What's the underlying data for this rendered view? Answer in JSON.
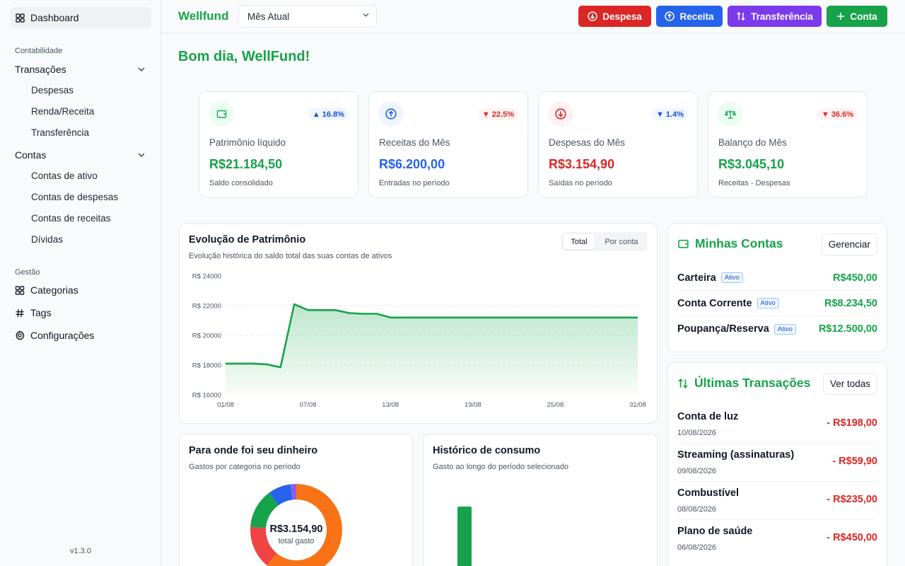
{
  "sidebar": {
    "dashboard": "Dashboard",
    "section_accounting": "Contabilidade",
    "transactions": {
      "label": "Transações",
      "items": [
        "Despesas",
        "Renda/Receita",
        "Transferência"
      ]
    },
    "accounts": {
      "label": "Contas",
      "items": [
        "Contas de ativo",
        "Contas de despesas",
        "Contas de receitas",
        "Dívidas"
      ]
    },
    "section_management": "Gestão",
    "management_items": [
      "Categorias",
      "Tags",
      "Configurações"
    ],
    "version": "v1.3.0"
  },
  "header": {
    "brand": "Wellfund",
    "period": "Mês Atual",
    "buttons": {
      "expense": "Despesa",
      "income": "Receita",
      "transfer": "Transferência",
      "account": "Conta"
    }
  },
  "greeting": "Bom dia, WellFund!",
  "kpis": [
    {
      "label": "Patrimônio líquido",
      "value": "R$21.184,50",
      "sub": "Saldo consolidado",
      "change": "16.8%",
      "direction": "up",
      "color": "#16a34a"
    },
    {
      "label": "Receitas do Mês",
      "value": "R$6.200,00",
      "sub": "Entradas no período",
      "change": "22.5%",
      "direction": "down",
      "color": "#2563eb"
    },
    {
      "label": "Despesas do Mês",
      "value": "R$3.154,90",
      "sub": "Saídas no período",
      "change": "1.4%",
      "direction": "down",
      "color": "#dc2626"
    },
    {
      "label": "Balanço do Mês",
      "value": "R$3.045,10",
      "sub": "Receitas - Despesas",
      "change": "36.6%",
      "direction": "down",
      "color": "#16a34a"
    }
  ],
  "evolution": {
    "title": "Evolução de Patrimônio",
    "subtitle": "Evolução histórica do saldo total das suas contas de ativos",
    "toggle": [
      "Total",
      "Por conta"
    ]
  },
  "spending": {
    "title": "Para onde foi seu dinheiro",
    "subtitle": "Gastos por categoria no período",
    "center_value": "R$3.154,90",
    "center_label": "total gasto"
  },
  "history": {
    "title": "Histórico de consumo",
    "subtitle": "Gasto ao longo do período selecionado"
  },
  "my_accounts": {
    "title": "Minhas Contas",
    "manage": "Gerenciar",
    "items": [
      {
        "name": "Carteira",
        "status": "Ativo",
        "value": "R$450,00"
      },
      {
        "name": "Conta Corrente",
        "status": "Ativo",
        "value": "R$8.234,50"
      },
      {
        "name": "Poupança/Reserva",
        "status": "Ativo",
        "value": "R$12.500,00"
      }
    ]
  },
  "last_transactions": {
    "title": "Últimas Transações",
    "view_all": "Ver todas",
    "items": [
      {
        "name": "Conta de luz",
        "date": "10/08/2026",
        "value": "- R$198,00"
      },
      {
        "name": "Streaming (assinaturas)",
        "date": "09/08/2026",
        "value": "- R$59,90"
      },
      {
        "name": "Combustível",
        "date": "08/08/2026",
        "value": "- R$235,00"
      },
      {
        "name": "Plano de saúde",
        "date": "06/08/2026",
        "value": "- R$450,00"
      }
    ]
  },
  "chart_data": [
    {
      "type": "area",
      "title": "Evolução de Patrimônio",
      "y_ticks": [
        "R$ 24000",
        "R$ 22000",
        "R$ 20000",
        "R$ 18000",
        "R$ 16000"
      ],
      "x_ticks": [
        "01/08",
        "07/08",
        "13/08",
        "19/08",
        "25/08",
        "31/08"
      ],
      "ylim": [
        16000,
        24000
      ],
      "x": [
        1,
        2,
        3,
        4,
        5,
        6,
        7,
        8,
        9,
        10,
        11,
        12,
        13,
        14,
        15,
        16,
        17,
        18,
        19,
        20,
        21,
        22,
        23,
        24,
        25,
        26,
        27,
        28,
        29,
        30,
        31
      ],
      "values": [
        18100,
        18100,
        18100,
        18050,
        17850,
        22100,
        21700,
        21700,
        21700,
        21500,
        21450,
        21450,
        21200,
        21200,
        21200,
        21200,
        21200,
        21200,
        21200,
        21200,
        21200,
        21200,
        21200,
        21200,
        21200,
        21200,
        21200,
        21200,
        21200,
        21200,
        21200
      ],
      "color": "#16a34a",
      "grid": true
    },
    {
      "type": "pie",
      "title": "Para onde foi seu dinheiro",
      "values": [
        61,
        15,
        14,
        8,
        2
      ],
      "colors": [
        "#f97316",
        "#ef4444",
        "#16a34a",
        "#2563eb",
        "#8b5cf6"
      ]
    },
    {
      "type": "bar",
      "title": "Histórico de consumo",
      "values": [
        1
      ],
      "colors": [
        "#16a34a"
      ]
    }
  ]
}
